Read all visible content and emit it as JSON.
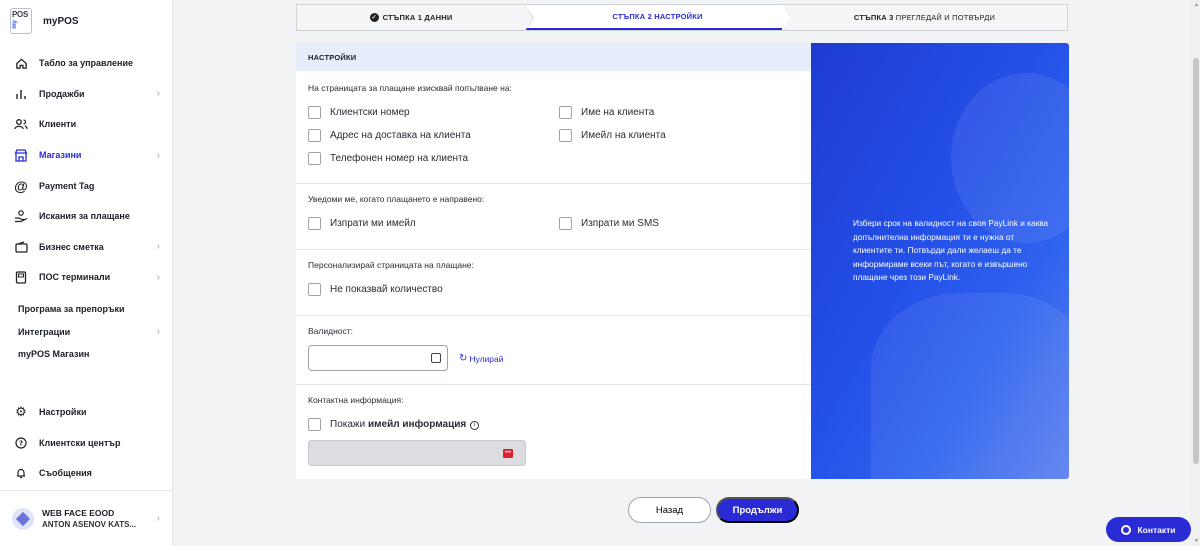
{
  "brand": {
    "name": "myPOS",
    "logo_top": "POS",
    "logo_side": "my"
  },
  "sidebar": {
    "items": [
      {
        "label": "Табло за управление",
        "icon": "home-icon",
        "chevron": false,
        "active": false
      },
      {
        "label": "Продажби",
        "icon": "bar-chart-icon",
        "chevron": true,
        "active": false
      },
      {
        "label": "Клиенти",
        "icon": "users-icon",
        "chevron": false,
        "active": false
      },
      {
        "label": "Магазини",
        "icon": "store-icon",
        "chevron": true,
        "active": true
      },
      {
        "label": "Payment Tag",
        "icon": "at-icon",
        "chevron": false,
        "active": false
      },
      {
        "label": "Искания за плащане",
        "icon": "hand-coin-icon",
        "chevron": false,
        "active": false
      },
      {
        "label": "Бизнес сметка",
        "icon": "wallet-icon",
        "chevron": true,
        "active": false
      },
      {
        "label": "ПОС терминали",
        "icon": "pos-terminal-icon",
        "chevron": true,
        "active": false
      }
    ],
    "secondary": [
      {
        "label": "Програма за препоръки",
        "chevron": false
      },
      {
        "label": "Интеграции",
        "chevron": true
      },
      {
        "label": "myPOS Магазин",
        "chevron": false
      }
    ],
    "bottom": [
      {
        "label": "Настройки",
        "icon": "gear-icon"
      },
      {
        "label": "Клиентски център",
        "icon": "help-icon"
      },
      {
        "label": "Съобщения",
        "icon": "bell-icon"
      }
    ],
    "account": {
      "company": "WEB FACE EOOD",
      "user": "ANTON ASENOV KATS..."
    }
  },
  "stepper": {
    "step1_label": "СТЪПКА 1 ДАННИ",
    "step2_label": "СТЪПКА 2 НАСТРОЙКИ",
    "step3_bold": "СТЪПКА 3",
    "step3_rest": " ПРЕГЛЕДАЙ И ПОТВЪРДИ"
  },
  "settings": {
    "header": "НАСТРОЙКИ",
    "required_title": "На страницата за плащане изисквай попълване на:",
    "required_left": [
      "Клиентски номер",
      "Адрес на доставка на клиента",
      "Телефонен номер на клиента"
    ],
    "required_right": [
      "Име на клиента",
      "Имейл на клиента"
    ],
    "notify_title": "Уведоми ме, когато плащането е направено:",
    "notify_email": "Изпрати ми имейл",
    "notify_sms": "Изпрати ми SMS",
    "customize_title": "Персонализирай страницата на плащане:",
    "hide_quantity": "Не показвай количество",
    "validity_title": "Валидност:",
    "validity_value": "",
    "reset_label": "Нулирай",
    "contact_title": "Контактна информация:",
    "show_prefix": "Покажи ",
    "show_bold": "имейл информация",
    "email_value": ""
  },
  "promo": {
    "text": "Избери срок на валидност на своя PayLink и каква допълнителна информация ти е нужна от клиентите ти. Потвърди дали желаеш да те информираме всеки път, когато е извършено плащане чрез този PayLink."
  },
  "actions": {
    "back": "Назад",
    "next": "Продължи"
  },
  "contact_button": "Контакти",
  "colors": {
    "accent": "#2b2bd6",
    "header_bg": "#e7eefb",
    "promo": "#2450e8"
  }
}
